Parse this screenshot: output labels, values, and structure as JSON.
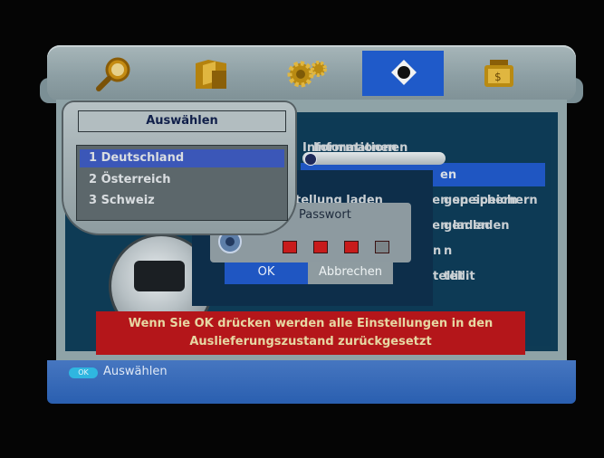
{
  "topbar": {
    "tabs": [
      {
        "icon": "magnifier-icon"
      },
      {
        "icon": "folder-icon"
      },
      {
        "icon": "gears-icon"
      },
      {
        "icon": "card-icon",
        "active": true
      },
      {
        "icon": "tv-icon"
      }
    ]
  },
  "menu": {
    "items": [
      "Informationen",
      "en",
      "gen speichern",
      "gen laden",
      "n",
      "tellit"
    ],
    "partial": "tellung laden"
  },
  "popup": {
    "title": "Auswählen",
    "options": [
      "1 Deutschland",
      "2 Österreich",
      "3 Schweiz"
    ],
    "selected_index": 0
  },
  "password": {
    "title": "Passwort",
    "pin_filled": 3,
    "pin_total": 4,
    "ok_label": "OK",
    "cancel_label": "Abbrechen"
  },
  "warning": {
    "line1": "Wenn Sie OK drücken werden alle Einstellungen in den",
    "line2": "Auslieferungszustand zurückgesetzt"
  },
  "footer": {
    "ok_key": "OK",
    "hint": "Auswählen"
  },
  "colors": {
    "accent": "#1f56c2",
    "warning": "#b4161a",
    "pin_on": "#c81b1b",
    "pin_off": "#7b8488"
  }
}
